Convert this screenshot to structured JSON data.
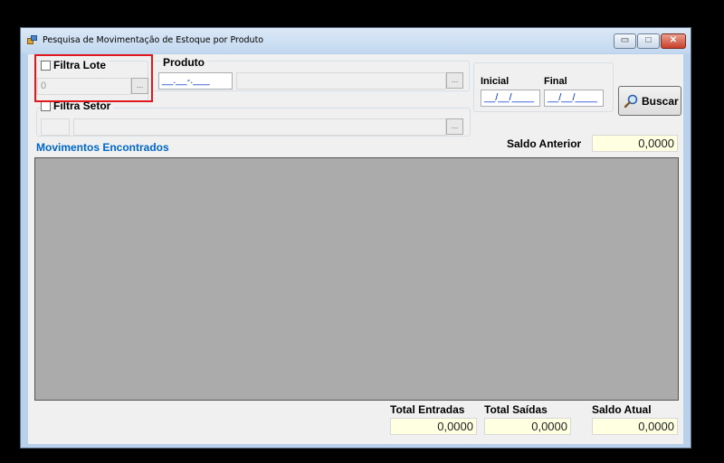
{
  "window": {
    "title": "Pesquisa de Movimentação de Estoque por Produto",
    "min_label": "▭",
    "max_label": "□",
    "close_label": "✕"
  },
  "lote": {
    "label": "Filtra Lote",
    "checked": false,
    "value": "0",
    "browse_label": "..."
  },
  "produto": {
    "label": "Produto",
    "code_mask": "__.__-.___",
    "description": "",
    "browse_label": "..."
  },
  "setor": {
    "label": "Filtra Setor",
    "checked": false,
    "code": "",
    "description": "",
    "browse_label": "..."
  },
  "periodo": {
    "inicial_label": "Inicial",
    "final_label": "Final",
    "inicial_mask": "__/__/____",
    "final_mask": "__/__/____"
  },
  "buscar": {
    "label": "Buscar",
    "icon": "magnifier-icon"
  },
  "saldo_anterior": {
    "label": "Saldo Anterior",
    "value": "0,0000"
  },
  "movimentos": {
    "label": "Movimentos Encontrados"
  },
  "totais": {
    "entradas_label": "Total Entradas",
    "entradas_value": "0,0000",
    "saidas_label": "Total Saídas",
    "saidas_value": "0,0000",
    "saldo_atual_label": "Saldo Atual",
    "saldo_atual_value": "0,0000"
  },
  "colors": {
    "heading_blue": "#0066cc",
    "highlight_red": "#e0191f",
    "grid_gray": "#ababab",
    "readonly_yellow": "#ffffe1"
  }
}
